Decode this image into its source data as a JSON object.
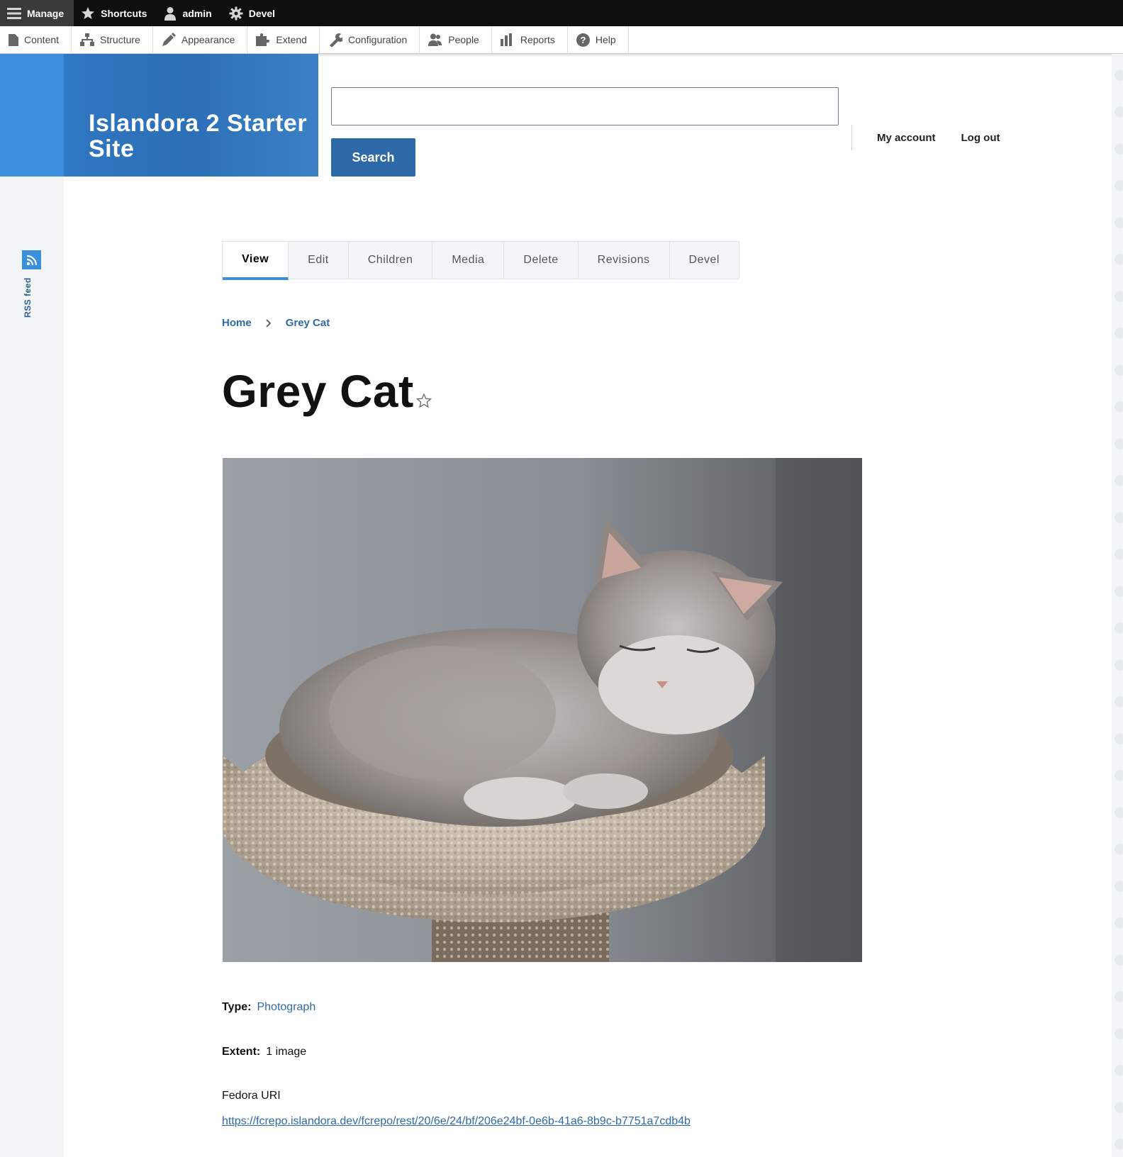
{
  "toolbar": {
    "tabs": [
      {
        "label": "Manage",
        "icon": "menu-icon"
      },
      {
        "label": "Shortcuts",
        "icon": "star-icon"
      },
      {
        "label": "admin",
        "icon": "person-icon"
      },
      {
        "label": "Devel",
        "icon": "gear-icon"
      }
    ],
    "tray": [
      {
        "label": "Content",
        "icon": "file-icon"
      },
      {
        "label": "Structure",
        "icon": "sitemap-icon"
      },
      {
        "label": "Appearance",
        "icon": "paintbrush-icon"
      },
      {
        "label": "Extend",
        "icon": "puzzle-icon"
      },
      {
        "label": "Configuration",
        "icon": "wrench-icon"
      },
      {
        "label": "People",
        "icon": "people-icon"
      },
      {
        "label": "Reports",
        "icon": "bar-chart-icon"
      },
      {
        "label": "Help",
        "icon": "question-icon"
      }
    ]
  },
  "header": {
    "site_name": "Islandora 2 Starter Site",
    "search": {
      "value": "",
      "button_label": "Search"
    },
    "account_links": [
      "My account",
      "Log out"
    ]
  },
  "sidebar": {
    "rss_label": "RSS feed"
  },
  "local_tasks": {
    "tabs": [
      "View",
      "Edit",
      "Children",
      "Media",
      "Delete",
      "Revisions",
      "Devel"
    ],
    "active": "View"
  },
  "breadcrumb": {
    "items": [
      "Home",
      "Grey Cat"
    ]
  },
  "node": {
    "title": "Grey Cat",
    "image_alt": "grey cat resting in a carpeted cat tree bed",
    "fields": {
      "type_label": "Type:",
      "type_value": "Photograph",
      "extent_label": "Extent:",
      "extent_value": "1 image",
      "fedora_label": "Fedora URI",
      "fedora_uri": "https://fcrepo.islandora.dev/fcrepo/rest/20/6e/24/bf/206e24bf-0e6b-41a6-8b9c-b7751a7cdb4b"
    }
  },
  "colors": {
    "brand_blue": "#2e6aa7",
    "accent_blue": "#3a8fdc",
    "toolbar_black": "#0f0f0f"
  }
}
